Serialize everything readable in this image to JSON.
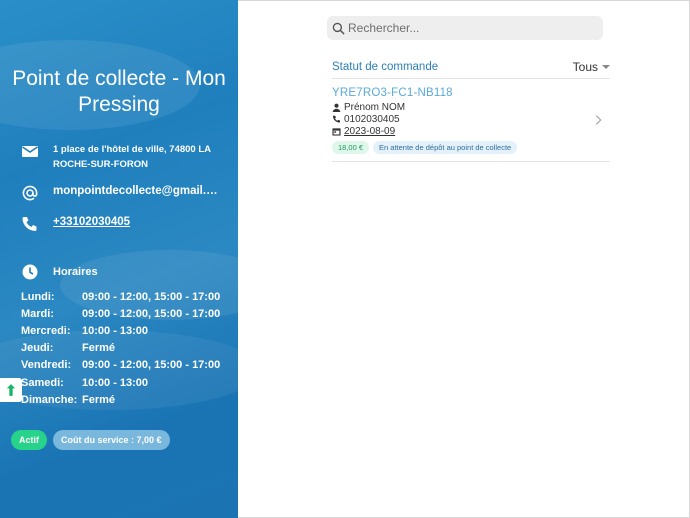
{
  "sidebar": {
    "title": "Point de collecte - Mon Pressing",
    "address": "1 place de l'hôtel de ville, 74800 LA ROCHE-SUR-FORON",
    "email": "monpointdecollecte@gmail.co...",
    "phone": "+33102030405",
    "hours_label": "Horaires",
    "hours": [
      {
        "day": "Lundi:",
        "time": "09:00 - 12:00, 15:00 - 17:00"
      },
      {
        "day": "Mardi:",
        "time": "09:00 - 12:00, 15:00 - 17:00"
      },
      {
        "day": "Mercredi:",
        "time": "10:00 - 13:00"
      },
      {
        "day": "Jeudi:",
        "time": "Fermé"
      },
      {
        "day": "Vendredi:",
        "time": "09:00 - 12:00, 15:00 - 17:00"
      },
      {
        "day": "Samedi:",
        "time": "10:00 - 13:00"
      },
      {
        "day": "Dimanche:",
        "time": "Fermé"
      }
    ],
    "badge_active": "Actif",
    "badge_cost": "Coût du service : 7,00 €",
    "icons": {
      "address": "mail-icon",
      "email": "at-icon",
      "phone": "phone-icon",
      "hours": "clock-icon"
    }
  },
  "search": {
    "placeholder": "Rechercher..."
  },
  "status_filter": {
    "label": "Statut de commande",
    "value": "Tous"
  },
  "orders": [
    {
      "id": "YRE7RO3-FC1-NB118",
      "customer": "Prénom NOM",
      "phone": "0102030405",
      "date": "2023-08-09",
      "price": "18,00 €",
      "status": "En attente de dépôt au point de collecte"
    }
  ],
  "colors": {
    "sidebar": "#1f7fbd",
    "accent": "#2a7fb8",
    "active_badge": "#27d38a"
  }
}
